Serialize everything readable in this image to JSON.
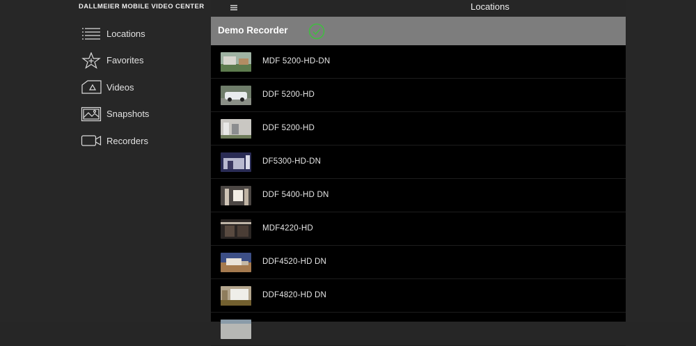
{
  "app": {
    "title": "DALLMEIER MOBILE VIDEO CENTER"
  },
  "sidebar": {
    "items": [
      {
        "label": "Locations",
        "icon": "list-icon"
      },
      {
        "label": "Favorites",
        "icon": "star-icon"
      },
      {
        "label": "Videos",
        "icon": "video-file-icon"
      },
      {
        "label": "Snapshots",
        "icon": "image-icon"
      },
      {
        "label": "Recorders",
        "icon": "camera-icon"
      }
    ]
  },
  "topbar": {
    "title": "Locations",
    "menu_icon": "hamburger-icon"
  },
  "header": {
    "recorder_name": "Demo Recorder",
    "status_icon": "check-circle-icon",
    "status_color": "#3fbf3f"
  },
  "cameras": [
    {
      "name": "MDF 5200-HD-DN"
    },
    {
      "name": "DDF 5200-HD"
    },
    {
      "name": "DDF 5200-HD"
    },
    {
      "name": "DF5300-HD-DN"
    },
    {
      "name": "DDF 5400-HD DN"
    },
    {
      "name": "MDF4220-HD"
    },
    {
      "name": "DDF4520-HD DN"
    },
    {
      "name": "DDF4820-HD DN"
    },
    {
      "name": ""
    }
  ]
}
